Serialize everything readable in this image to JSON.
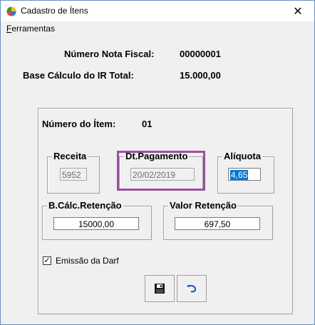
{
  "window": {
    "title": "Cadastro de Ítens",
    "close_glyph": "✕"
  },
  "menu": {
    "prefix": "F",
    "rest": "erramentas"
  },
  "header": {
    "nota_label": "Número Nota Fiscal:",
    "nota_value": "00000001",
    "base_label": "Base Cálculo do IR Total:",
    "base_value": "15.000,00"
  },
  "item": {
    "label": "Número do Ítem:",
    "value": "01"
  },
  "fields": {
    "receita_label": "Receita",
    "receita_value": "5952",
    "dtpag_label": "Dt.Pagamento",
    "dtpag_value": "20/02/2019",
    "aliquota_label": "Alíquota",
    "aliquota_value": "4,65",
    "bcalc_label": "B.Cálc.Retenção",
    "bcalc_value": "15000,00",
    "valor_label": "Valor Retenção",
    "valor_value": "697,50"
  },
  "darf": {
    "label": "Emissão da Darf",
    "checked": true,
    "check_glyph": "✓"
  },
  "colors": {
    "highlight": "#9b4fa0",
    "selection": "#0078d7"
  }
}
